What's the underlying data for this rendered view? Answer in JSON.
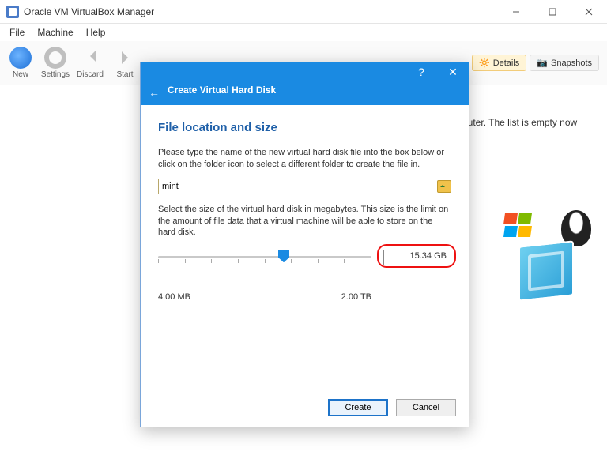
{
  "window": {
    "title": "Oracle VM VirtualBox Manager"
  },
  "menu": {
    "file": "File",
    "machine": "Machine",
    "help": "Help"
  },
  "toolbar": {
    "new": "New",
    "settings": "Settings",
    "discard": "Discard",
    "start": "Start"
  },
  "tabs": {
    "details": "Details",
    "snapshots": "Snapshots"
  },
  "welcome": {
    "fragment": "puter. The list is empty now"
  },
  "dialog": {
    "title": "Create Virtual Hard Disk",
    "section": "File location and size",
    "p1": "Please type the name of the new virtual hard disk file into the box below or click on the folder icon to select a different folder to create the file in.",
    "filename": "mint",
    "p2": "Select the size of the virtual hard disk in megabytes. This size is the limit on the amount of file data that a virtual machine will be able to store on the hard disk.",
    "min": "4.00 MB",
    "max": "2.00 TB",
    "size": "15.34 GB",
    "create": "Create",
    "cancel": "Cancel"
  }
}
